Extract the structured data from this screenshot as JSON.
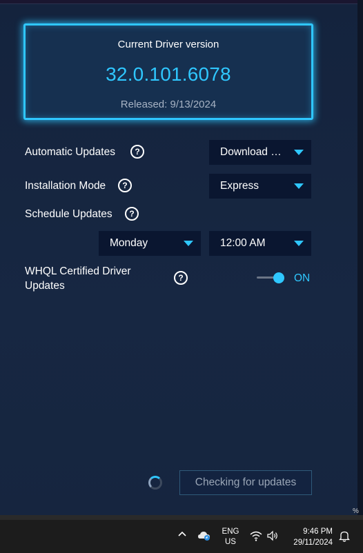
{
  "driver": {
    "title": "Current Driver version",
    "version": "32.0.101.6078",
    "released": "Released: 9/13/2024"
  },
  "settings": {
    "automatic_updates": {
      "label": "Automatic Updates",
      "value": "Download and install"
    },
    "installation_mode": {
      "label": "Installation Mode",
      "value": "Express"
    },
    "schedule_updates": {
      "label": "Schedule Updates",
      "day": "Monday",
      "time": "12:00 AM"
    },
    "whql": {
      "label": "WHQL Certified Driver Updates",
      "state": "ON",
      "enabled": true
    },
    "help_glyph": "?"
  },
  "status": {
    "button_label": "Checking for updates"
  },
  "taskbar": {
    "language": "ENG",
    "region": "US",
    "time": "9:46 PM",
    "date": "29/11/2024",
    "overflow_percent": "%"
  },
  "colors": {
    "accent": "#2fc7ff",
    "background": "#14233d",
    "dropdown": "#0a1630"
  }
}
